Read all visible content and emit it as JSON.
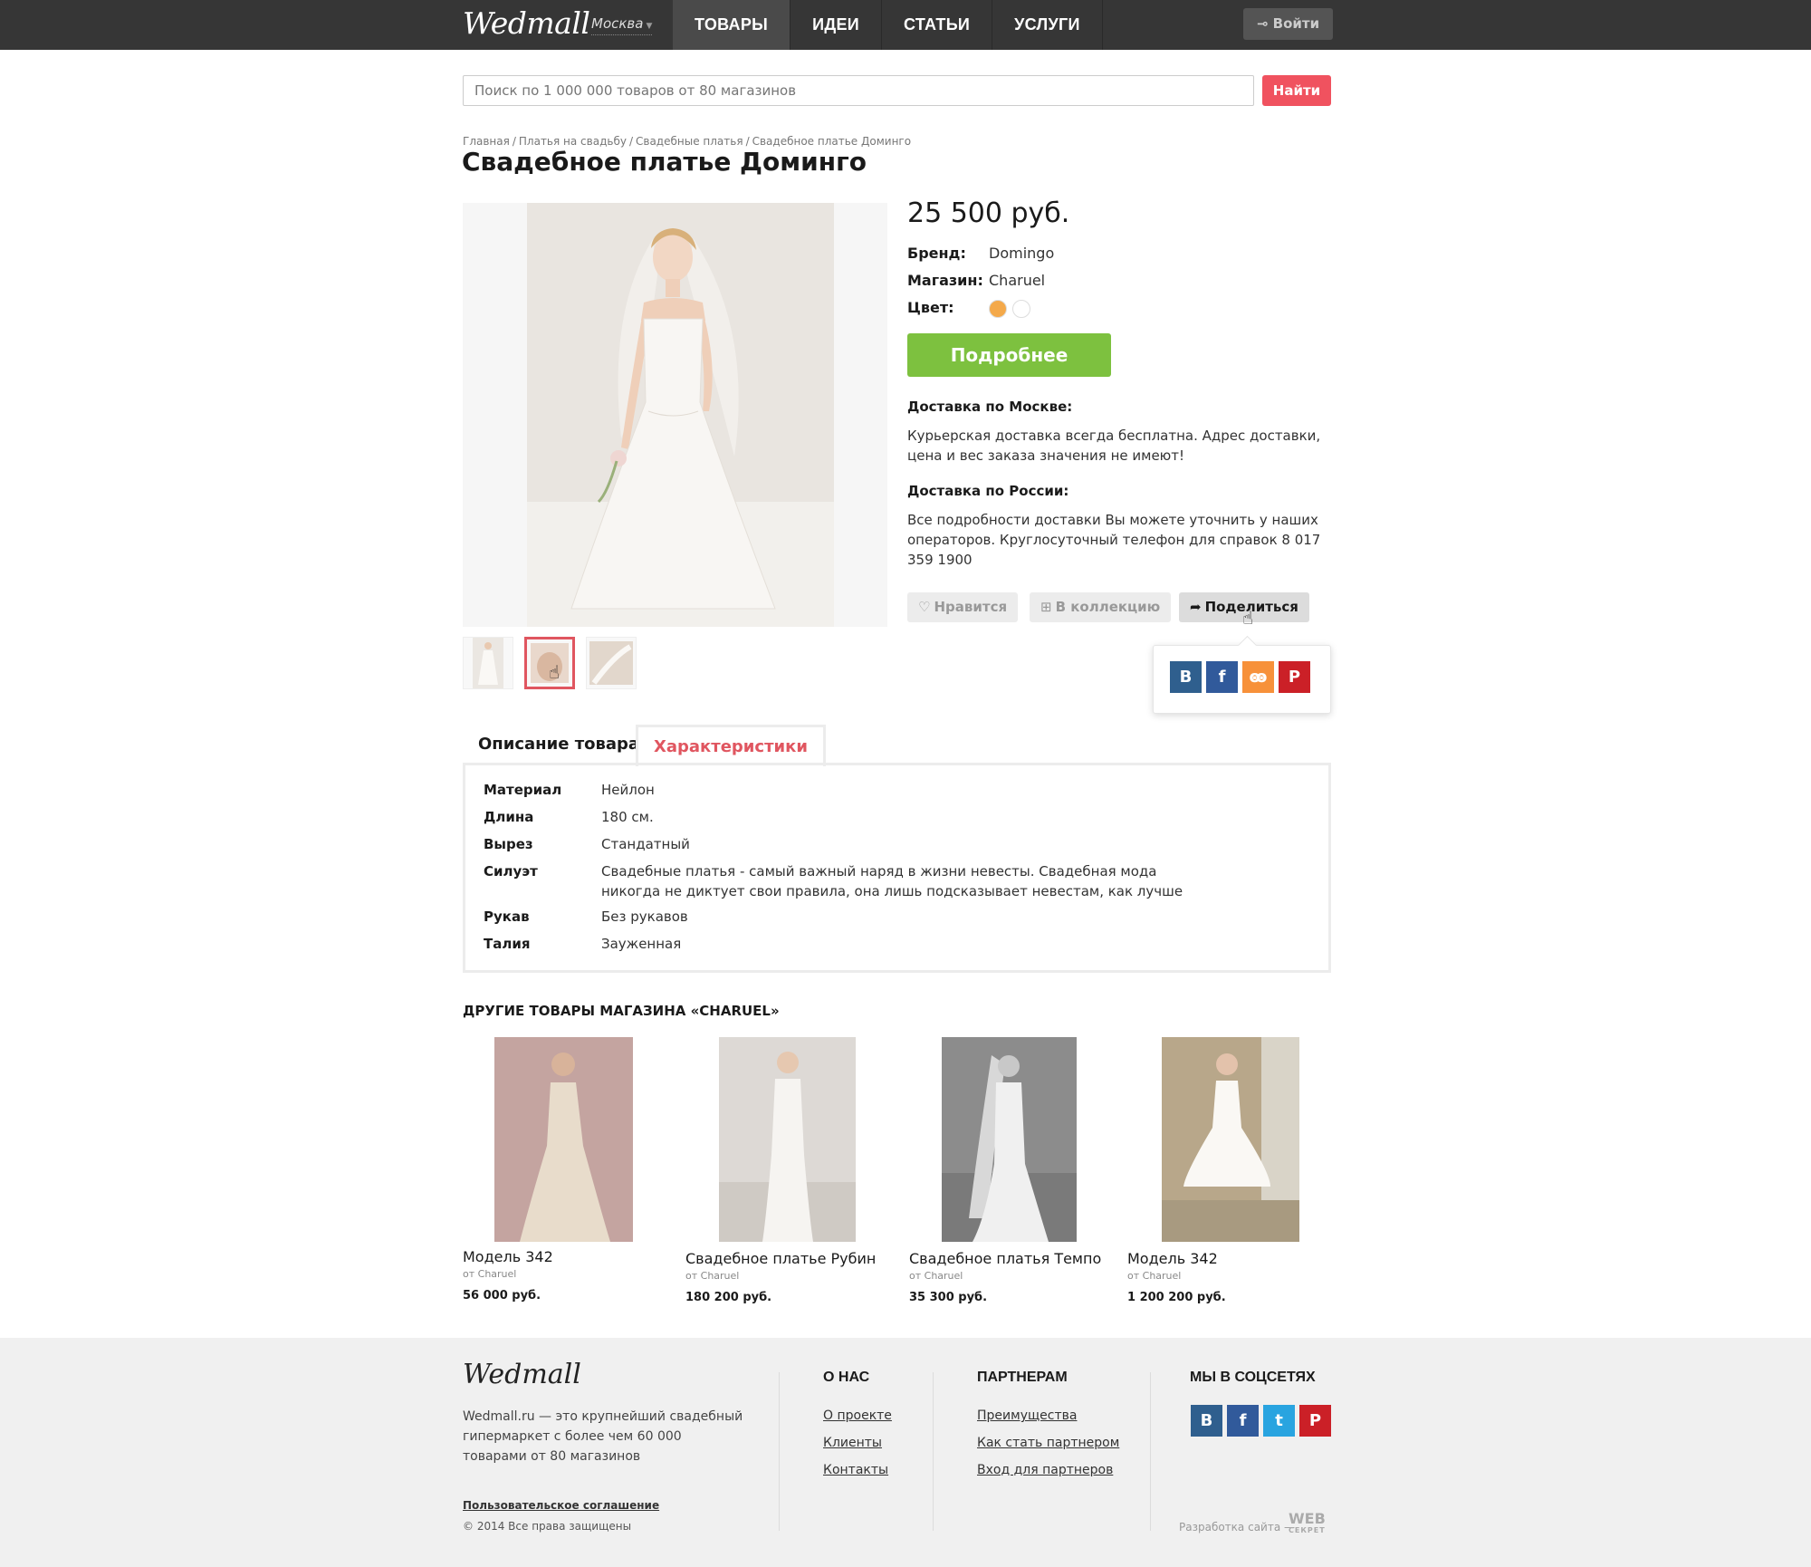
{
  "header": {
    "logo": "Wedmall",
    "city": "Москва",
    "nav": [
      "ТОВАРЫ",
      "ИДЕИ",
      "СТАТЬИ",
      "УСЛУГИ"
    ],
    "login": "Войти"
  },
  "search": {
    "placeholder": "Поиск по 1 000 000 товаров от 80 магазинов",
    "button": "Найти"
  },
  "breadcrumb": [
    "Главная",
    "Платья на свадьбу",
    "Свадебные платья",
    "Свадебное платье Доминго"
  ],
  "product": {
    "title": "Свадебное платье Доминго",
    "price": "25 500 руб.",
    "brand_label": "Бренд:",
    "brand": "Domingo",
    "shop_label": "Магазин:",
    "shop": "Charuel",
    "color_label": "Цвет:",
    "colors": [
      "#f4a94a",
      "#ffffff"
    ],
    "more_button": "Подробнее",
    "delivery_moscow_title": "Доставка по Москве:",
    "delivery_moscow_text": "Курьерская доставка всегда бесплатна. Адрес доставки, цена и вес заказа значения не имеют!",
    "delivery_russia_title": "Доставка по России:",
    "delivery_russia_text": "Все подробности доставки Вы можете уточнить у наших операторов. Круглосуточный телефон для справок 8 017 359 1900",
    "like_button": "Нравится",
    "collection_button": "В коллекцию",
    "share_button": "Поделиться"
  },
  "share_networks": [
    "В",
    "f",
    "ok",
    "P"
  ],
  "tabs": {
    "description": "Описание товара",
    "specs": "Характеристики"
  },
  "specs": [
    {
      "key": "Материал",
      "value": "Нейлон"
    },
    {
      "key": "Длина",
      "value": "180 см."
    },
    {
      "key": "Вырез",
      "value": "Стандатный"
    },
    {
      "key": "Силуэт",
      "value": "Свадебные платья - самый важный наряд в жизни невесты. Свадебная мода никогда не диктует свои правила, она лишь подсказывает невестам, как лучше"
    },
    {
      "key": "Рукав",
      "value": "Без рукавов"
    },
    {
      "key": "Талия",
      "value": "Зауженная"
    }
  ],
  "related": {
    "title": "ДРУГИЕ ТОВАРЫ МАГАЗИНА «CHARUEL»",
    "items": [
      {
        "name": "Модель 342",
        "from": "от Charuel",
        "price": "56 000 руб."
      },
      {
        "name": "Свадебное платье Рубин",
        "from": "от Charuel",
        "price": "180 200 руб."
      },
      {
        "name": "Свадебное платья Темпо",
        "from": "от Charuel",
        "price": "35 300 руб."
      },
      {
        "name": "Модель 342",
        "from": "от Charuel",
        "price": "1 200 200 руб."
      }
    ]
  },
  "footer": {
    "logo": "Wedmall",
    "about": "Wedmall.ru — это крупнейший свадебный гипермаркет с более чем 60 000 товарами от 80 магазинов",
    "agreement": "Пользовательское соглашение",
    "copyright": "© 2014 Все права защищены",
    "about_title": "О НАС",
    "about_links": [
      "О проекте",
      "Клиенты",
      "Контакты"
    ],
    "partners_title": "ПАРТНЕРАМ",
    "partners_links": [
      "Преимущества",
      "Как стать партнером",
      "Вход для партнеров"
    ],
    "social_title": "МЫ В СОЦСЕТЯХ",
    "dev_text": "Разработка сайта  —",
    "dev_logo_top": "WEB",
    "dev_logo_bottom": "СЕКРЕТ"
  },
  "colors": {
    "accent_red": "#f0525f",
    "accent_green": "#7dc13f",
    "topbar": "#363636"
  }
}
